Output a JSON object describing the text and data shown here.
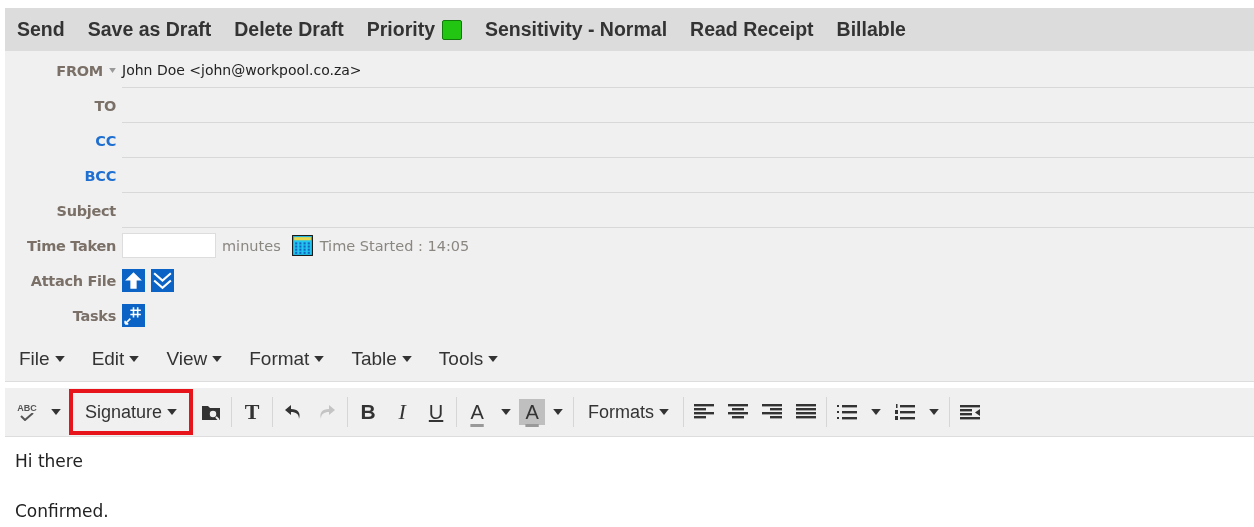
{
  "actions": [
    {
      "label": "Send"
    },
    {
      "label": "Save as Draft"
    },
    {
      "label": "Delete Draft"
    },
    {
      "label": "Priority",
      "color": "#22c511"
    },
    {
      "label": "Sensitivity - Normal"
    },
    {
      "label": "Read Receipt"
    },
    {
      "label": "Billable"
    }
  ],
  "fields": [
    {
      "label": "FROM",
      "color": "#7a7068",
      "dropdown": true,
      "value": "John Doe <john@workpool.co.za>"
    },
    {
      "label": "TO",
      "color": "#7a7068",
      "dropdown": false
    },
    {
      "label": "CC",
      "color": "#1f6fd1",
      "dropdown": false
    },
    {
      "label": "BCC",
      "color": "#1f6fd1",
      "dropdown": false
    },
    {
      "label": "Subject",
      "color": "#7a7068",
      "dropdown": false
    }
  ],
  "time": {
    "label": "Time Taken",
    "unit": "minutes",
    "started": "Time Started : 14:05"
  },
  "attach": {
    "label": "Attach File"
  },
  "tasks": {
    "label": "Tasks"
  },
  "menubar": [
    {
      "label": "File"
    },
    {
      "label": "Edit"
    },
    {
      "label": "View"
    },
    {
      "label": "Format"
    },
    {
      "label": "Table"
    },
    {
      "label": "Tools"
    }
  ],
  "toolbar": [
    [
      {
        "kind": "spell",
        "label": "ABC"
      },
      {
        "kind": "caret"
      },
      {
        "kind": "menu",
        "label": "Signature",
        "highlighted": true
      },
      {
        "kind": "folder"
      }
    ],
    [
      {
        "kind": "glyph",
        "label": "T"
      }
    ],
    [
      {
        "kind": "undo",
        "disabled": false
      },
      {
        "kind": "redo",
        "disabled": true
      }
    ],
    [
      {
        "kind": "bold",
        "label": "B"
      },
      {
        "kind": "italic",
        "label": "I"
      },
      {
        "kind": "underline",
        "label": "U"
      }
    ],
    [
      {
        "kind": "textcolor",
        "label": "A"
      },
      {
        "kind": "caret"
      },
      {
        "kind": "backcolor",
        "label": "A"
      },
      {
        "kind": "caret"
      }
    ],
    [
      {
        "kind": "menu",
        "label": "Formats",
        "highlighted": false
      }
    ],
    [
      {
        "kind": "align-left"
      },
      {
        "kind": "align-center"
      },
      {
        "kind": "align-right"
      },
      {
        "kind": "align-justify"
      }
    ],
    [
      {
        "kind": "bullets"
      },
      {
        "kind": "caret"
      },
      {
        "kind": "numbers"
      },
      {
        "kind": "caret"
      }
    ],
    [
      {
        "kind": "indent"
      }
    ]
  ],
  "body": [
    "Hi there",
    "Confirmed."
  ]
}
